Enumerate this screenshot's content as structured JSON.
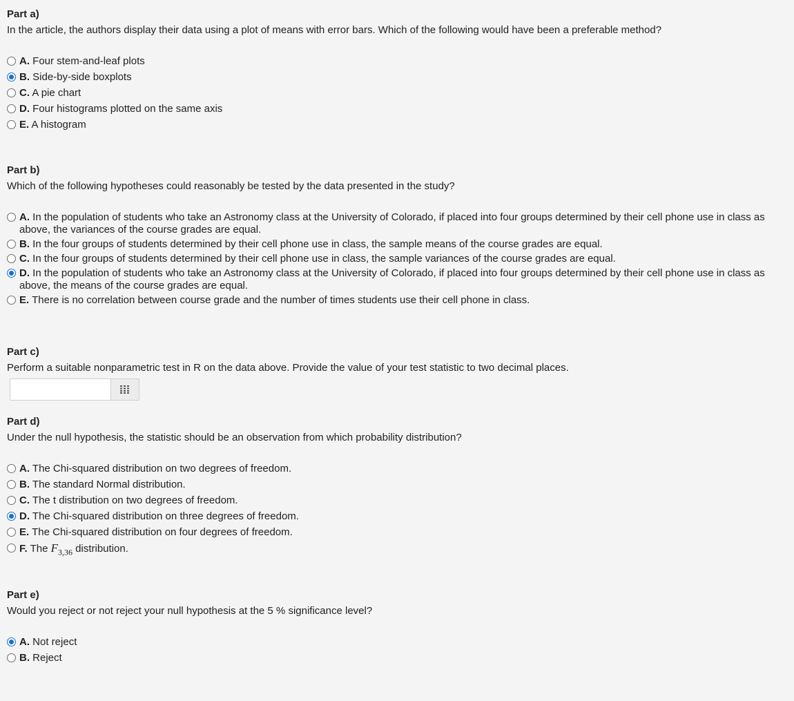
{
  "part_a": {
    "title": "Part a)",
    "question": "In the article, the authors display their data using a plot of means with error bars. Which of the following would have been a preferable method?",
    "options": [
      {
        "letter": "A.",
        "text": "Four stem-and-leaf plots",
        "selected": false
      },
      {
        "letter": "B.",
        "text": "Side-by-side boxplots",
        "selected": true
      },
      {
        "letter": "C.",
        "text": "A pie chart",
        "selected": false
      },
      {
        "letter": "D.",
        "text": "Four histograms plotted on the same axis",
        "selected": false
      },
      {
        "letter": "E.",
        "text": "A histogram",
        "selected": false
      }
    ]
  },
  "part_b": {
    "title": "Part b)",
    "question": "Which of the following hypotheses could reasonably be tested by the data presented in the study?",
    "options": [
      {
        "letter": "A.",
        "text": "In the population of students who take an Astronomy class at the University of Colorado, if placed into four groups determined by their cell phone use in class as above, the variances of the course grades are equal.",
        "selected": false
      },
      {
        "letter": "B.",
        "text": "In the four groups of students determined by their cell phone use in class, the sample means of the course grades are equal.",
        "selected": false
      },
      {
        "letter": "C.",
        "text": "In the four groups of students determined by their cell phone use in class, the sample variances of the course grades are equal.",
        "selected": false
      },
      {
        "letter": "D.",
        "text": "In the population of students who take an Astronomy class at the University of Colorado, if placed into four groups determined by their cell phone use in class as above, the means of the course grades are equal.",
        "selected": true
      },
      {
        "letter": "E.",
        "text": "There is no correlation between course grade and the number of times students use their cell phone in class.",
        "selected": false
      }
    ]
  },
  "part_c": {
    "title": "Part c)",
    "question": "Perform a suitable nonparametric test in R on the data above. Provide the value of your test statistic to two decimal places.",
    "input_value": "",
    "keypad_icon": "keypad-grid-icon"
  },
  "part_d": {
    "title": "Part d)",
    "question": "Under the null hypothesis, the statistic should be an observation from which probability distribution?",
    "options": [
      {
        "letter": "A.",
        "text": "The Chi-squared distribution on two degrees of freedom.",
        "selected": false
      },
      {
        "letter": "B.",
        "text": "The standard Normal distribution.",
        "selected": false
      },
      {
        "letter": "C.",
        "text": "The t distribution on two degrees of freedom.",
        "selected": false
      },
      {
        "letter": "D.",
        "text": "The Chi-squared distribution on three degrees of freedom.",
        "selected": true
      },
      {
        "letter": "E.",
        "text": "The Chi-squared distribution on four degrees of freedom.",
        "selected": false
      }
    ],
    "option_f": {
      "letter": "F.",
      "prefix": "The ",
      "symbol": "F",
      "subscript": "3,36",
      "suffix": " distribution.",
      "selected": false
    }
  },
  "part_e": {
    "title": "Part e)",
    "question": "Would you reject or not reject your null hypothesis at the 5 % significance level?",
    "options": [
      {
        "letter": "A.",
        "text": "Not reject",
        "selected": true
      },
      {
        "letter": "B.",
        "text": "Reject",
        "selected": false
      }
    ]
  },
  "colors": {
    "radio_selected": "#1a6fd0",
    "background": "#f4f4f4"
  }
}
